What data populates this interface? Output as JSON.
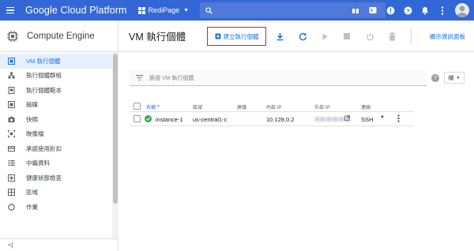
{
  "topbar": {
    "brand": "Google Cloud Platform",
    "project": "RediPage",
    "icons": [
      "menu-icon",
      "search-icon",
      "gift-icon",
      "cloud-shell-icon",
      "alert-icon",
      "help-icon",
      "notifications-icon",
      "more-vert-icon",
      "account-avatar"
    ]
  },
  "sidebar": {
    "title": "Compute Engine",
    "items": [
      {
        "label": "VM 執行個體",
        "icon": "vm-instances-icon",
        "active": true
      },
      {
        "label": "執行個體群組",
        "icon": "instance-groups-icon"
      },
      {
        "label": "執行個體範本",
        "icon": "instance-templates-icon"
      },
      {
        "label": "磁碟",
        "icon": "disk-icon"
      },
      {
        "label": "快照",
        "icon": "snapshot-icon"
      },
      {
        "label": "映像檔",
        "icon": "image-icon"
      },
      {
        "label": "承諾使用折扣",
        "icon": "committed-use-icon"
      },
      {
        "label": "中繼資料",
        "icon": "metadata-icon"
      },
      {
        "label": "健康狀態檢查",
        "icon": "health-check-icon"
      },
      {
        "label": "區域",
        "icon": "zones-icon"
      },
      {
        "label": "作業",
        "icon": "operations-icon"
      }
    ],
    "collapse": "<|"
  },
  "actionbar": {
    "title": "VM 執行個體",
    "create_label": "建立執行個體",
    "info_link": "顯示資訊面板"
  },
  "filter": {
    "placeholder": "篩選 VM 執行個體",
    "columns_label": "欄"
  },
  "table": {
    "columns": [
      "名稱",
      "區域",
      "建議",
      "內部 IP",
      "外部 IP",
      "連線"
    ],
    "sort_indicator": "^",
    "rows": [
      {
        "name": "instance-1",
        "zone": "us-central1-c",
        "recommendation": "",
        "internal_ip": "10.128.0.2",
        "external_ip": "",
        "connect": "SSH",
        "status": "running"
      }
    ]
  },
  "colors": {
    "topbar": "#3367d6",
    "accent": "#1a73e8",
    "highlight_border": "#e02020",
    "status_ok": "#34a853"
  }
}
